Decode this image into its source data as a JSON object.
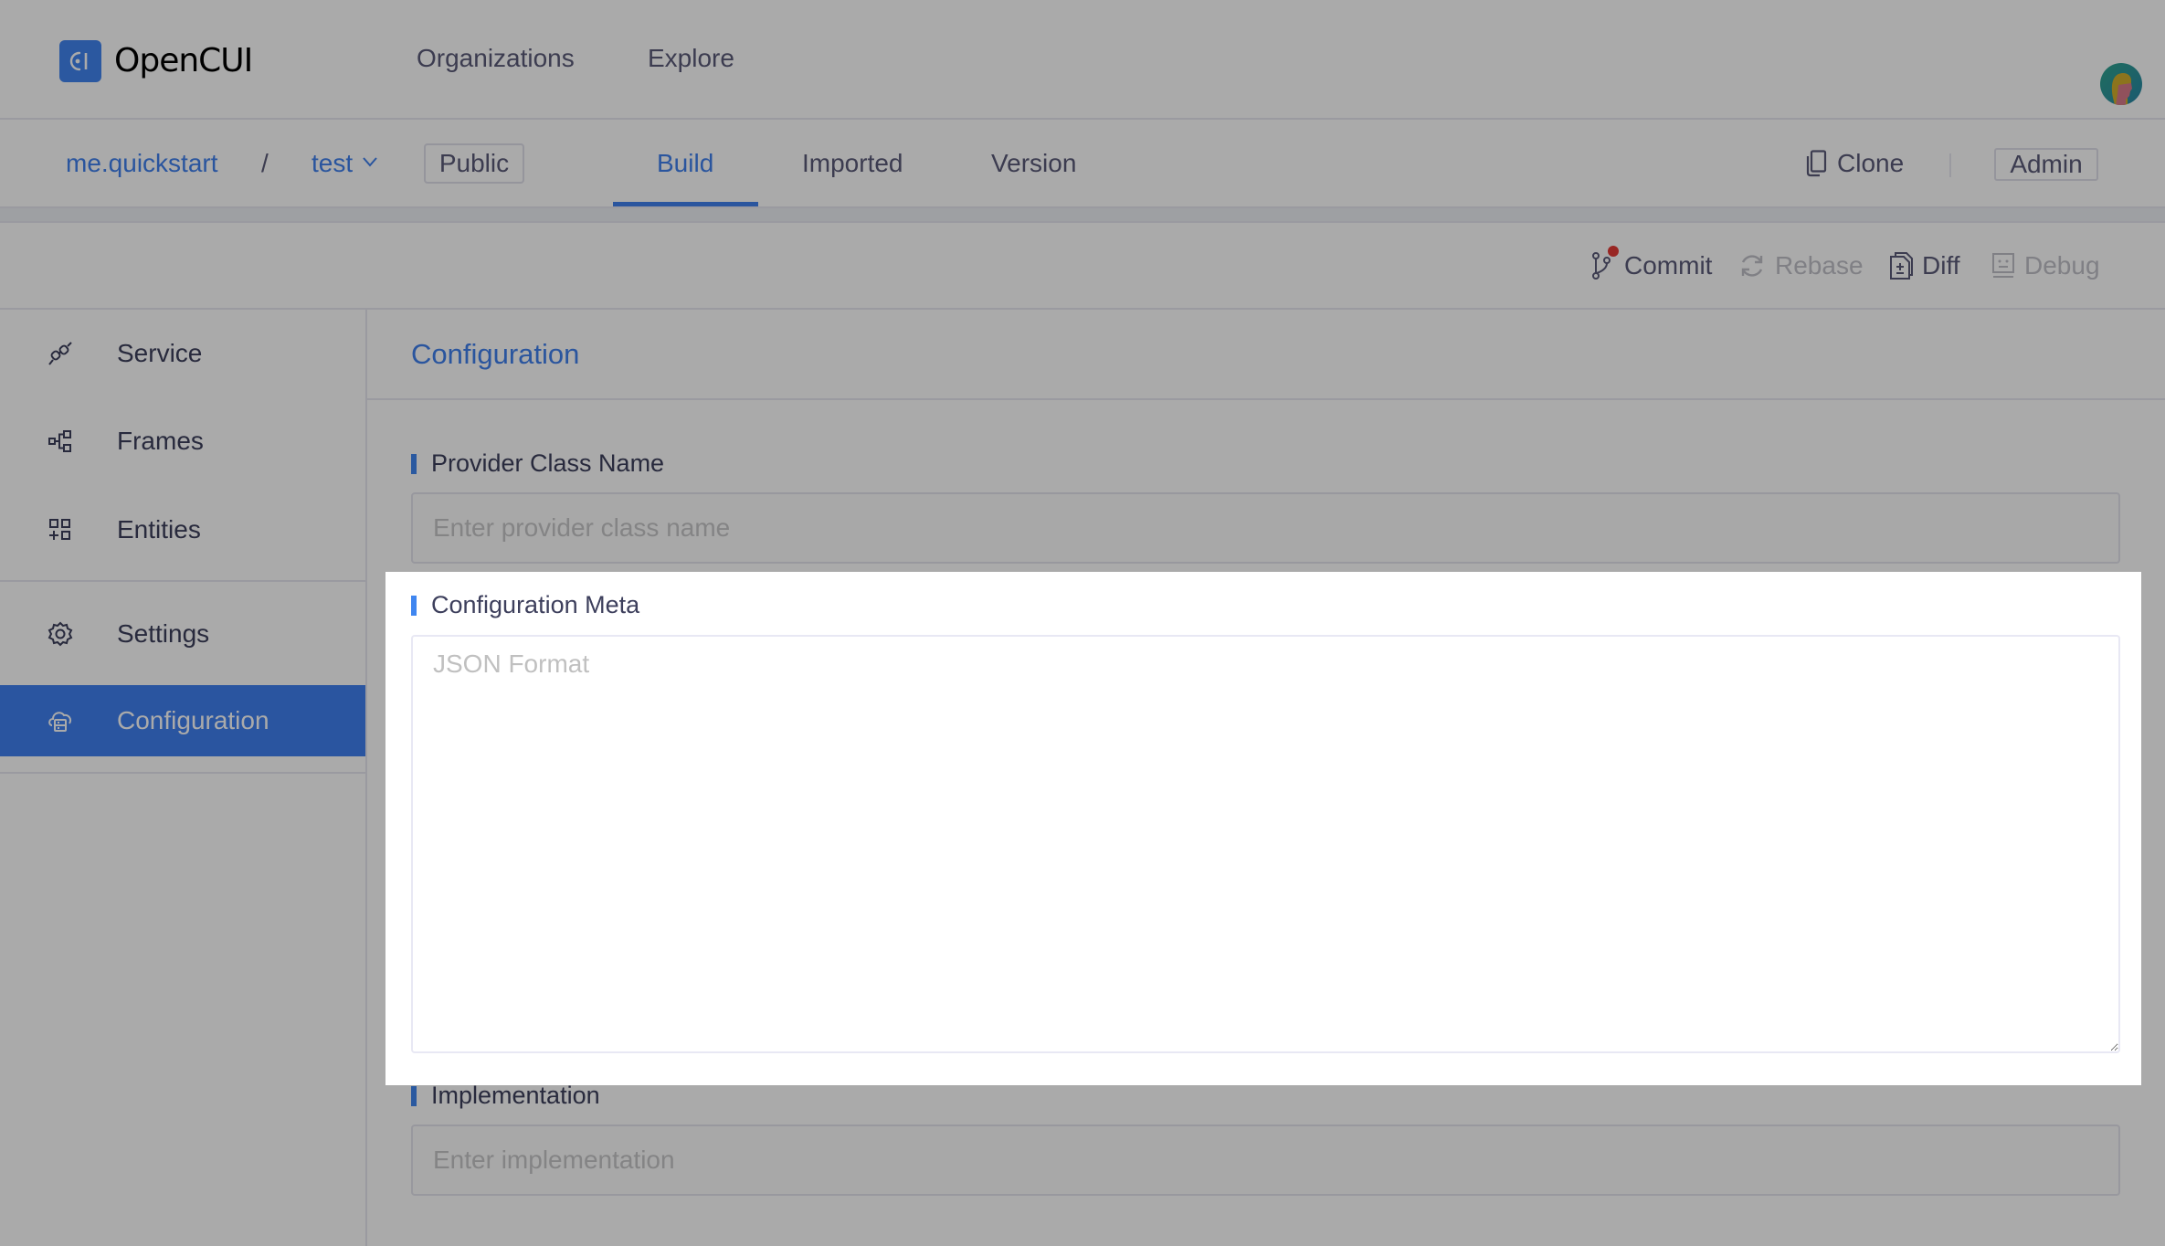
{
  "app": {
    "logo_glyph": "C|",
    "name": "OpenCUI",
    "brand_color": "#4184f0",
    "accent_color": "#3f80ee"
  },
  "topnav": {
    "items": [
      {
        "label": "Organizations"
      },
      {
        "label": "Explore"
      }
    ],
    "avatar_icon": "user-avatar"
  },
  "project_bar": {
    "breadcrumb": {
      "org": "me.quickstart",
      "separator": "/",
      "project": "test",
      "project_dropdown_icon": "chevron-down-icon"
    },
    "visibility_badge": "Public",
    "tabs": [
      {
        "label": "Build",
        "active": true
      },
      {
        "label": "Imported",
        "active": false
      },
      {
        "label": "Version",
        "active": false
      }
    ],
    "clone_label": "Clone",
    "admin_label": "Admin"
  },
  "toolbar": {
    "commit": {
      "label": "Commit",
      "has_notification": true,
      "notification_color": "#e53935"
    },
    "rebase": {
      "label": "Rebase",
      "disabled": true
    },
    "diff": {
      "label": "Diff",
      "disabled": false
    },
    "debug": {
      "label": "Debug",
      "disabled": true
    }
  },
  "sidebar": {
    "items": [
      {
        "label": "Service",
        "icon": "plug-icon",
        "selected": false
      },
      {
        "label": "Frames",
        "icon": "hierarchy-icon",
        "selected": false
      },
      {
        "label": "Entities",
        "icon": "grid-add-icon",
        "selected": false
      },
      {
        "label": "Settings",
        "icon": "gear-icon",
        "selected": false
      },
      {
        "label": "Configuration",
        "icon": "cloud-server-icon",
        "selected": true
      }
    ]
  },
  "main": {
    "title": "Configuration",
    "fields": {
      "provider_class_name": {
        "label": "Provider Class Name",
        "value": "",
        "placeholder": "Enter provider class name"
      },
      "configuration_meta": {
        "label": "Configuration Meta",
        "value": "",
        "placeholder": "JSON Format"
      },
      "implementation": {
        "label": "Implementation",
        "value": "",
        "placeholder": "Enter implementation"
      }
    }
  }
}
